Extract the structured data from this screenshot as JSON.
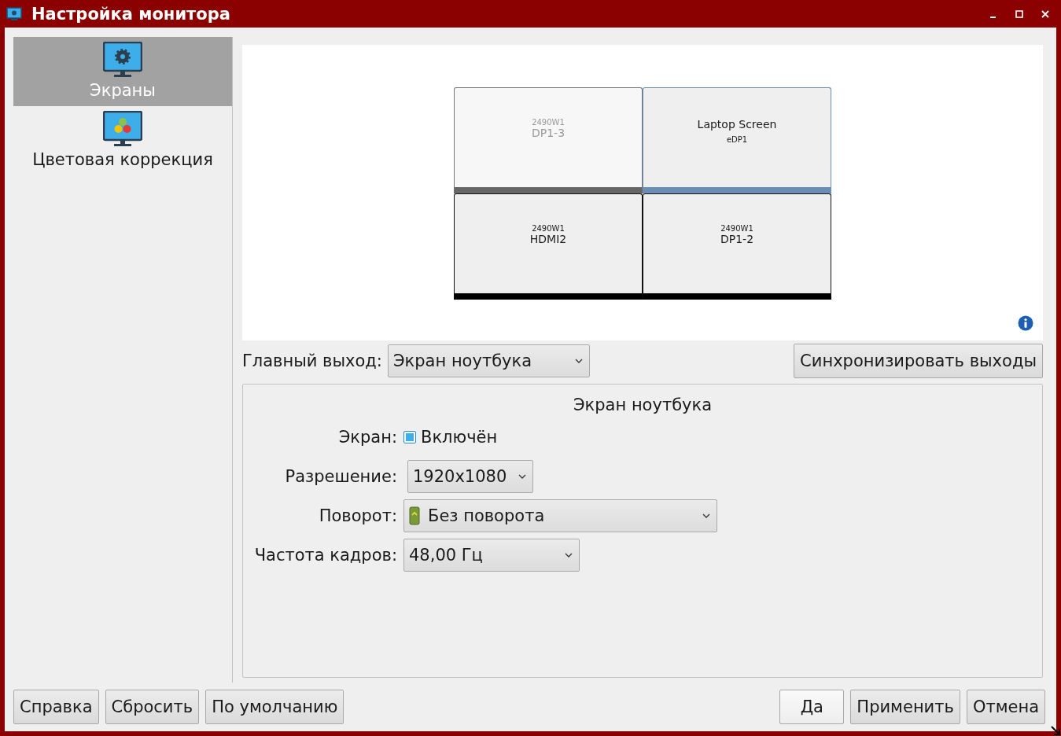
{
  "window": {
    "title": "Настройка монитора"
  },
  "sidebar": {
    "items": [
      {
        "label": "Экраны",
        "kind": "screens",
        "selected": true
      },
      {
        "label": "Цветовая коррекция",
        "kind": "color",
        "selected": false
      }
    ]
  },
  "layout": {
    "monitors": [
      {
        "kind": "external",
        "model": "2490W1",
        "output": "DP1-3",
        "enabled": false,
        "selected": false
      },
      {
        "kind": "laptop",
        "model": "Laptop Screen",
        "output": "eDP1",
        "enabled": true,
        "selected": true
      },
      {
        "kind": "external",
        "model": "2490W1",
        "output": "HDMI2",
        "enabled": true,
        "selected": false
      },
      {
        "kind": "external",
        "model": "2490W1",
        "output": "DP1-2",
        "enabled": true,
        "selected": false
      }
    ]
  },
  "primary_output": {
    "label": "Главный выход:",
    "value": "Экран ноутбука"
  },
  "sync_button": "Синхронизировать выходы",
  "details": {
    "title": "Экран ноутбука",
    "fields": [
      {
        "kind": "checkbox",
        "label": "Экран:",
        "value": "Включён",
        "checked": true
      },
      {
        "kind": "dropdown",
        "label": "Разрешение:",
        "value": "1920x1080"
      },
      {
        "kind": "icon-dropdown",
        "label": "Поворот:",
        "value": "Без поворота"
      },
      {
        "kind": "dropdown",
        "label": "Частота кадров:",
        "value": "48,00 Гц"
      }
    ]
  },
  "footer": {
    "left_buttons": [
      {
        "label": "Справка",
        "default": false
      },
      {
        "label": "Сбросить",
        "default": false
      },
      {
        "label": "По умолчанию",
        "default": false
      }
    ],
    "right_buttons": [
      {
        "label": "Да",
        "default": true
      },
      {
        "label": "Применить",
        "default": false
      },
      {
        "label": "Отмена",
        "default": false
      }
    ]
  }
}
